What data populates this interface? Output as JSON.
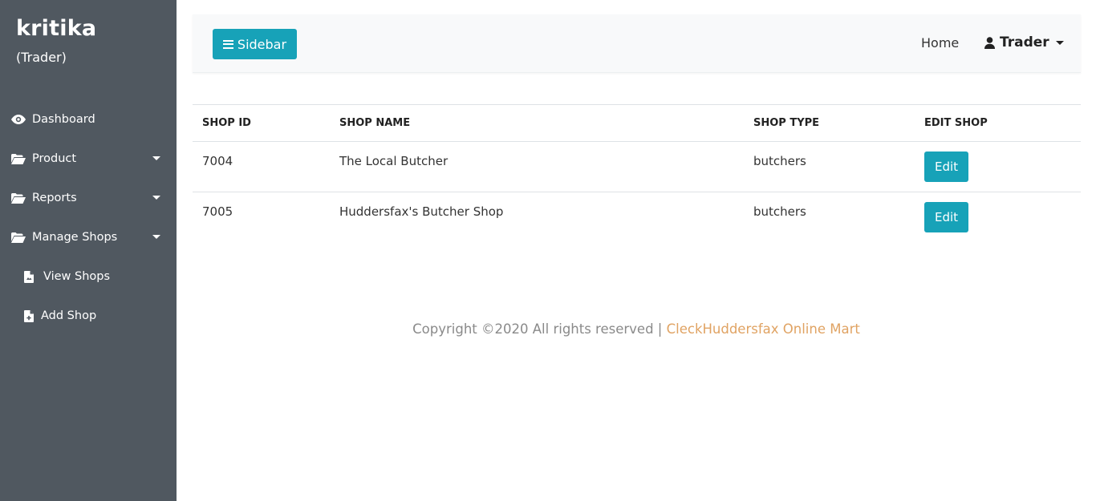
{
  "sidebar": {
    "username": "kritika",
    "role": "(Trader)",
    "items": [
      {
        "label": "Dashboard",
        "icon": "eye-icon"
      },
      {
        "label": "Product",
        "icon": "folder-open-icon"
      },
      {
        "label": "Reports",
        "icon": "folder-open-icon"
      },
      {
        "label": "Manage Shops",
        "icon": "folder-open-icon"
      }
    ],
    "subitems": [
      {
        "label": "View Shops",
        "icon": "file-icon"
      },
      {
        "label": "Add Shop",
        "icon": "file-plus-icon"
      }
    ]
  },
  "topbar": {
    "sidebar_button": "Sidebar",
    "home": "Home",
    "user": "Trader"
  },
  "table": {
    "headers": [
      "SHOP ID",
      "SHOP NAME",
      "SHOP TYPE",
      "EDIT SHOP"
    ],
    "rows": [
      {
        "id": "7004",
        "name": "The Local Butcher",
        "type": "butchers",
        "action": "Edit"
      },
      {
        "id": "7005",
        "name": "Huddersfax's Butcher Shop",
        "type": "butchers",
        "action": "Edit"
      }
    ]
  },
  "footer": {
    "text": "Copyright ©2020 All rights reserved | ",
    "brand": "CleckHuddersfax Online Mart"
  },
  "colors": {
    "sidebar_bg": "#505860",
    "accent": "#17a2b8",
    "brand": "#e0a363"
  }
}
